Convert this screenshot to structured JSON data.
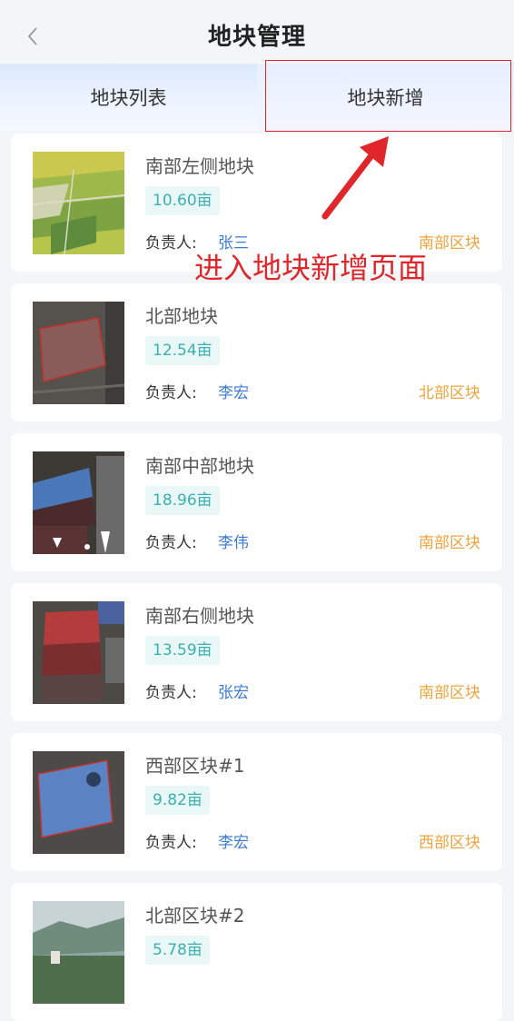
{
  "header": {
    "title": "地块管理",
    "back_icon": "chevron-left-icon"
  },
  "tabs": [
    {
      "label": "地块列表"
    },
    {
      "label": "地块新增"
    }
  ],
  "annotation": {
    "text": "进入地块新增页面",
    "color": "#e0262b"
  },
  "plots": [
    {
      "name": "南部左侧地块",
      "area": "10.60亩",
      "owner_label": "负责人:",
      "owner": "张三",
      "zone": "南部区块"
    },
    {
      "name": "北部地块",
      "area": "12.54亩",
      "owner_label": "负责人:",
      "owner": "李宏",
      "zone": "北部区块"
    },
    {
      "name": "南部中部地块",
      "area": "18.96亩",
      "owner_label": "负责人:",
      "owner": "李伟",
      "zone": "南部区块"
    },
    {
      "name": "南部右侧地块",
      "area": "13.59亩",
      "owner_label": "负责人:",
      "owner": "张宏",
      "zone": "南部区块"
    },
    {
      "name": "西部区块#1",
      "area": "9.82亩",
      "owner_label": "负责人:",
      "owner": "李宏",
      "zone": "西部区块"
    },
    {
      "name": "北部区块#2",
      "area": "5.78亩"
    }
  ],
  "colors": {
    "accent_teal": "#3ab0b3",
    "owner_blue": "#3a7bd5",
    "zone_orange": "#f0a33a"
  }
}
